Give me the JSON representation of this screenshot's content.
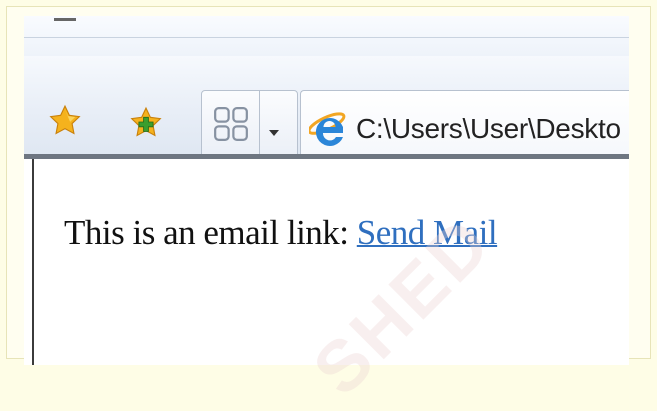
{
  "browser": {
    "address": "C:\\Users\\User\\Deskto",
    "icons": {
      "favorites": "favorites-star-icon",
      "add_favorites": "add-to-favorites-icon",
      "quick_tabs": "quick-tabs-icon",
      "tab_list": "tab-list-dropdown-icon",
      "page": "internet-explorer-icon"
    }
  },
  "page": {
    "text": "This is an email link: ",
    "link_text": "Send Mail"
  },
  "colors": {
    "link": "#2f6fbf",
    "star": "#f5b21d",
    "add_star": "#3c9e2e",
    "background": "#fefde6"
  },
  "watermark": {
    "text": "SHED"
  }
}
